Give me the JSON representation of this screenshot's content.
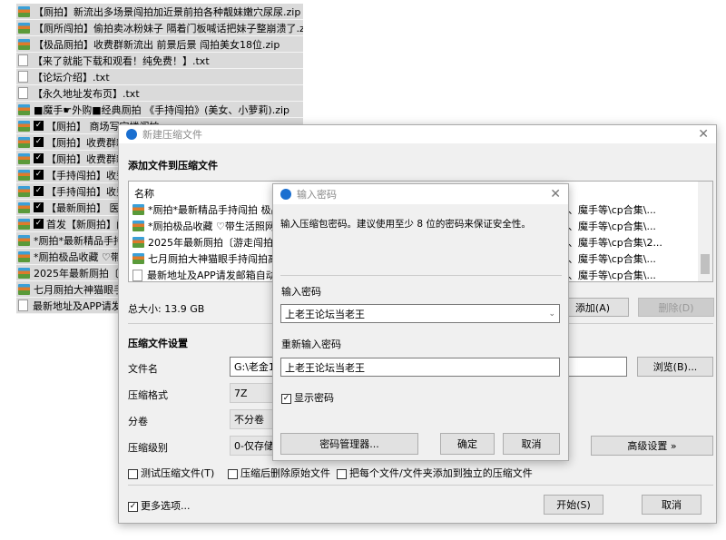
{
  "background_files": [
    {
      "name": "【厕拍】新流出多场景闯拍加近景前拍各种靓妹嫩穴尿尿.zip",
      "type": "zip",
      "checked": false
    },
    {
      "name": "【厕所闯拍】偷拍卖冰粉妹子 隔着门板喊话把妹子整崩溃了.zip",
      "type": "zip",
      "checked": false
    },
    {
      "name": "【极品厕拍】收费群新流出 前景后景 闯拍美女18位.zip",
      "type": "zip",
      "checked": false
    },
    {
      "name": "【来了就能下载和观看！纯免费！】.txt",
      "type": "txt",
      "checked": false
    },
    {
      "name": "【论坛介绍】.txt",
      "type": "txt",
      "checked": false
    },
    {
      "name": "【永久地址发布页】.txt",
      "type": "txt",
      "checked": false
    },
    {
      "name": "■魔手☛外购■经典厕拍 《手持闯拍》(美女、小萝莉).zip",
      "type": "zip",
      "checked": false
    },
    {
      "name": "【厕拍】 商场写字楼闯拍",
      "type": "zip",
      "checked": true
    },
    {
      "name": "【厕拍】收费群新",
      "type": "zip",
      "checked": true
    },
    {
      "name": "【厕拍】收费群新",
      "type": "zip",
      "checked": true
    },
    {
      "name": "【手持闯拍】收费",
      "type": "zip",
      "checked": true
    },
    {
      "name": "【手持闯拍】收费",
      "type": "zip",
      "checked": true
    },
    {
      "name": "【最新厕拍】 医院",
      "type": "zip",
      "checked": true
    },
    {
      "name": "首发【新厕拍】闯",
      "type": "zip",
      "checked": true
    },
    {
      "name": "*厕拍*最新精品手持",
      "type": "zip",
      "checked": false
    },
    {
      "name": "*厕拍极品收藏 ♡带",
      "type": "zip",
      "checked": false
    },
    {
      "name": "2025年最新厕拍〔游",
      "type": "zip",
      "checked": false
    },
    {
      "name": "七月厕拍大神猫眼手持",
      "type": "zip",
      "checked": false
    },
    {
      "name": "最新地址及APP请发邮",
      "type": "txt",
      "checked": false
    }
  ],
  "main_dialog": {
    "title": "新建压缩文件",
    "section_add": "添加文件到压缩文件",
    "column_name": "名称",
    "files": [
      {
        "name": "*厕拍*最新精品手持闯拍 极品",
        "path": "、魔手等\\cp合集\\...",
        "type": "zip"
      },
      {
        "name": "*厕拍极品收藏 ♡带生活照网红",
        "path": "、魔手等\\cp合集\\...",
        "type": "zip"
      },
      {
        "name": "2025年最新厕拍〔游走闯拍〕高",
        "path": "、魔手等\\cp合集\\2...",
        "type": "zip"
      },
      {
        "name": "七月厕拍大神猫眼手持闯拍高校",
        "path": "、魔手等\\cp合集\\...",
        "type": "zip"
      },
      {
        "name": "最新地址及APP请发邮箱自动获",
        "path": "、魔手等\\cp合集\\...",
        "type": "txt"
      }
    ],
    "total_size": "总大小: 13.9 GB",
    "add_button": "添加(A)",
    "delete_button": "删除(D)",
    "section_settings": "压缩文件设置",
    "filename_label": "文件名",
    "filename_value": "G:\\老金10",
    "browse_button": "浏览(B)...",
    "format_label": "压缩格式",
    "format_value": "7Z",
    "split_label": "分卷",
    "split_value": "不分卷",
    "level_label": "压缩级别",
    "level_value": "0-仅存储",
    "advanced_button": "高级设置 »",
    "test_archive": "测试压缩文件(T)",
    "delete_after": "压缩后删除原始文件",
    "separate_archives": "把每个文件/文件夹添加到独立的压缩文件",
    "more_options": "更多选项...",
    "start_button": "开始(S)",
    "cancel_button": "取消"
  },
  "password_dialog": {
    "title": "输入密码",
    "hint": "输入压缩包密码。建议使用至少 8 位的密码来保证安全性。",
    "password_label": "输入密码",
    "password_value": "上老王论坛当老王",
    "reenter_label": "重新输入密码",
    "reenter_value": "上老王论坛当老王",
    "show_password": "显示密码",
    "manager_button": "密码管理器...",
    "ok_button": "确定",
    "cancel_button": "取消"
  }
}
